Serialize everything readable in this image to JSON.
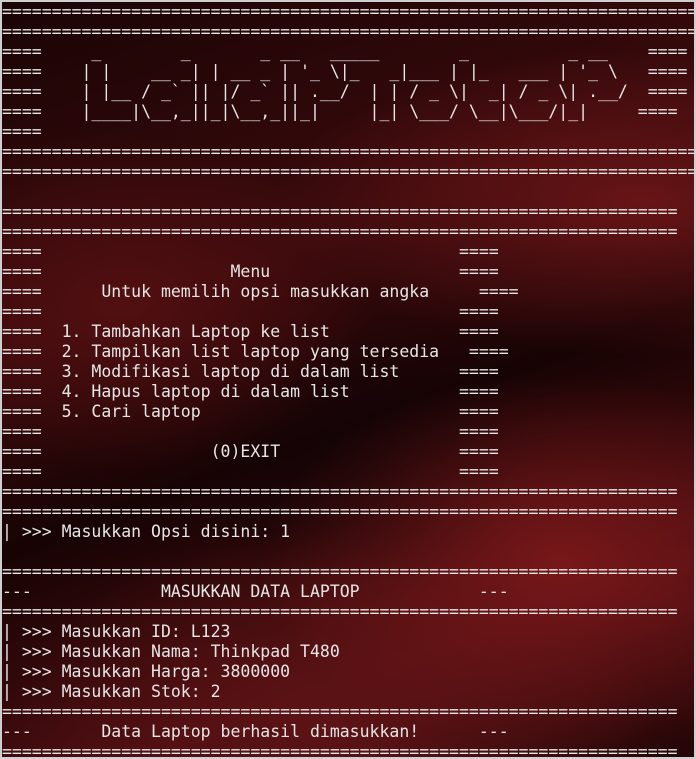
{
  "terminal": {
    "banner": [
      "==========================================================================================",
      "==========================================================================================",
      "====     _        _       _ __   _____        _          _ __    ====",
      "====    | |    __ _| | __ _ | '_ \\|_   _|___ | |_   ___ | '_ \\   ====",
      "====    | |__ / _` || |/ _` || .__/  | | / _ \\|  _| / _ \\| .__/  ====",
      "====    |____|\\__,_||_|\\__,_||_|     |_| \\___/ \\__|\\___/|_|     ====",
      "====                                                                                  ====",
      "==========================================================================================",
      "=========================================================================================="
    ],
    "menu_box": [
      "====================================================================",
      "====================================================================",
      "====                                          ====",
      "====                   Menu                   ====",
      "====      Untuk memilih opsi masukkan angka     ===="
    ],
    "menu_blank": "====                                          ====",
    "menu_items": [
      "====  1. Tambahkan Laptop ke list             ====",
      "====  2. Tampilkan list laptop yang tersedia   ====",
      "====  3. Modifikasi laptop di dalam list      ====",
      "====  4. Hapus laptop di dalam list           ====",
      "====  5. Cari laptop                          ===="
    ],
    "exit_line": "====                 (0)EXIT                  ====",
    "separator": "====================================================================",
    "option_prompt": "| >>> Masukkan Opsi disini: ",
    "option_value": "1",
    "section_title_line": "---             MASUKKAN DATA LAPTOP            ---",
    "inputs": [
      {
        "prompt": "| >>> Masukkan ID: ",
        "value": "L123"
      },
      {
        "prompt": "| >>> Masukkan Nama: ",
        "value": "Thinkpad T480"
      },
      {
        "prompt": "| >>> Masukkan Harga: ",
        "value": "3800000"
      },
      {
        "prompt": "| >>> Masukkan Stok: ",
        "value": "2"
      }
    ],
    "success_line": "---       Data Laptop berhasil dimasukkan!      ---"
  }
}
